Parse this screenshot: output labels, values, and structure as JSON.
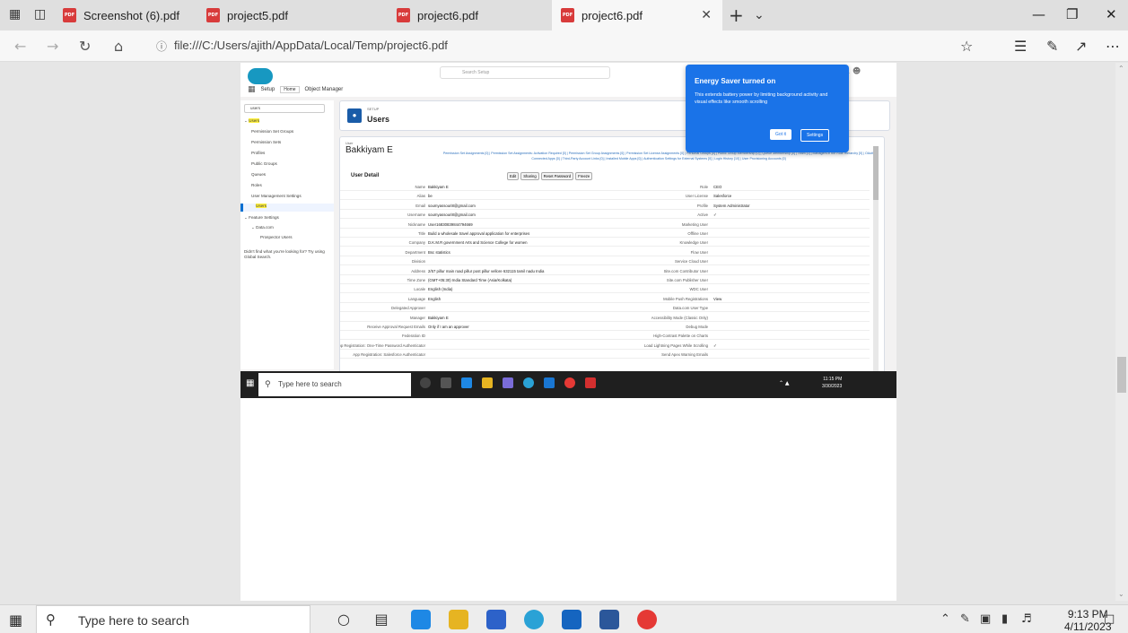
{
  "browser": {
    "tabs": [
      {
        "label": "Screenshot (6).pdf"
      },
      {
        "label": "project5.pdf"
      },
      {
        "label": "project6.pdf"
      },
      {
        "label": "project6.pdf"
      }
    ],
    "address": "file:///C:/Users/ajith/AppData/Local/Temp/project6.pdf"
  },
  "shot": {
    "search_placeholder": "Search Setup",
    "app_name": "Setup",
    "app_tabs": [
      "Home",
      "Object Manager"
    ],
    "quick_find": "users",
    "left_nav": {
      "group": "Users",
      "items": [
        "Permission Set Groups",
        "Permission Sets",
        "Profiles",
        "Public Groups",
        "Queues",
        "Roles",
        "User Management Settings",
        "Users"
      ],
      "feature_group": "Feature Settings",
      "data_group": "Data.com",
      "prospector": "Prospector Users",
      "help": "Didn't find what you're looking for? Try using Global Search."
    },
    "page_eyebrow": "SETUP",
    "page_title": "Users",
    "user_label": "User",
    "user_name": "Bakkiyam E",
    "links": "Permission Set Assignments [0] | Permission Set Assignments: Activation Required [0] | Permission Set Group Assignments [0] | Permission Set License Assignments [0] | Personal Groups [0] | Public Group Membership [0] | Queue Membership [0] | Team [0] | Managers in the Role Hierarchy [0] | OAuth Connected Apps [0] | Third-Party Account Links [0] | Installed Mobile Apps [0] | Authentication Settings for External Systems [0] | Login History [10] | User Provisioning Accounts [0]",
    "section_title": "User Detail",
    "buttons": [
      "Edit",
      "Sharing",
      "Reset Password",
      "Freeze"
    ],
    "rows": [
      {
        "l1": "Name",
        "v1": "Bakkiyam E",
        "l2": "Role",
        "v2": "CEO"
      },
      {
        "l1": "Alias",
        "v1": "be",
        "l2": "User License",
        "v2": "Salesforce"
      },
      {
        "l1": "Email",
        "v1": "soumyassouri8@gmail.com",
        "l2": "Profile",
        "v2": "System Administrator"
      },
      {
        "l1": "Username",
        "v1": "soumyassouri8@gmail.com",
        "l2": "Active",
        "v2": "✓"
      },
      {
        "l1": "Nickname",
        "v1": "User16830839844794669",
        "l2": "Marketing User",
        "v2": ""
      },
      {
        "l1": "Title",
        "v1": "Build a wholesale travel approval application for enterprises",
        "l2": "Offline User",
        "v2": ""
      },
      {
        "l1": "Company",
        "v1": "D.K.M.R government Arts and Science College for women",
        "l2": "Knowledge User",
        "v2": ""
      },
      {
        "l1": "Department",
        "v1": "Bsc statistics",
        "l2": "Flow User",
        "v2": ""
      },
      {
        "l1": "Division",
        "v1": "",
        "l2": "Service Cloud User",
        "v2": ""
      },
      {
        "l1": "Address",
        "v1": "2/57 pillur main road pillur post pillur vellore 632115 tamil nadu India",
        "l2": "Site.com Contributor User",
        "v2": ""
      },
      {
        "l1": "Time Zone",
        "v1": "(GMT+05:30) India Standard Time (Asia/Kolkata)",
        "l2": "Site.com Publisher User",
        "v2": ""
      },
      {
        "l1": "Locale",
        "v1": "English (India)",
        "l2": "WDC User",
        "v2": ""
      },
      {
        "l1": "Language",
        "v1": "English",
        "l2": "Mobile Push Registrations",
        "v2": "View"
      },
      {
        "l1": "Delegated Approver",
        "v1": "",
        "l2": "Data.com User Type",
        "v2": ""
      },
      {
        "l1": "Manager",
        "v1": "Bakkiyam E",
        "l2": "Accessibility Mode (Classic Only)",
        "v2": ""
      },
      {
        "l1": "Receive Approval Request Emails",
        "v1": "Only if I am an approver",
        "l2": "Debug Mode",
        "v2": ""
      },
      {
        "l1": "Federation ID",
        "v1": "",
        "l2": "High-Contrast Palette on Charts",
        "v2": ""
      },
      {
        "l1": "App Registration: One-Time Password Authenticator",
        "v1": "",
        "l2": "Load Lightning Pages While Scrolling",
        "v2": "✓"
      },
      {
        "l1": "App Registration: Salesforce Authenticator",
        "v1": "",
        "l2": "Send Apex Warning Emails",
        "v2": ""
      }
    ],
    "energy": {
      "title": "Energy Saver turned on",
      "body": "This extends battery power by limiting background activity and visual effects like smooth scrolling",
      "got_it": "Got it",
      "settings": "Settings"
    },
    "inner_search": "Type here to search",
    "inner_time": "11:15 PM",
    "inner_date": "3/30/2023"
  },
  "taskbar": {
    "search_placeholder": "Type here to search",
    "time": "9:13 PM",
    "date": "4/11/2023"
  },
  "colors": {
    "pdf_icon": "#d83b3b",
    "salesforce_blue": "#1798c1",
    "energy_popup": "#1a73e8"
  }
}
